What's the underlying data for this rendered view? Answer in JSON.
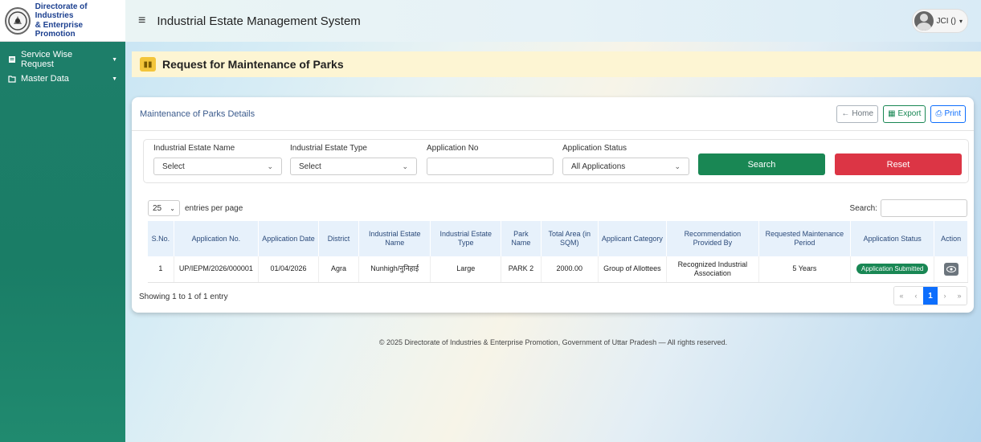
{
  "brand": {
    "line1": "Directorate of Industries",
    "line2": "& Enterprise Promotion"
  },
  "sidebar": {
    "items": [
      {
        "label": "Service Wise Request",
        "icon": "file-icon"
      },
      {
        "label": "Master Data",
        "icon": "folder-icon"
      }
    ]
  },
  "header": {
    "title": "Industrial Estate Management System",
    "user": "JCI ()"
  },
  "page": {
    "title": "Request for Maintenance of Parks"
  },
  "card": {
    "title": "Maintenance of Parks Details",
    "home": "Home",
    "export": "Export",
    "print": "Print"
  },
  "filters": {
    "estate_name_label": "Industrial Estate Name",
    "estate_name_value": "Select",
    "estate_type_label": "Industrial Estate Type",
    "estate_type_value": "Select",
    "app_no_label": "Application No",
    "app_no_value": "",
    "status_label": "Application Status",
    "status_value": "All Applications",
    "search": "Search",
    "reset": "Reset"
  },
  "table_controls": {
    "entries_value": "25",
    "entries_label": "entries per page",
    "search_label": "Search:"
  },
  "table": {
    "columns": [
      "S.No.",
      "Application No.",
      "Application Date",
      "District",
      "Industrial Estate Name",
      "Industrial Estate Type",
      "Park Name",
      "Total Area (in SQM)",
      "Applicant Category",
      "Recommendation Provided By",
      "Requested Maintenance Period",
      "Application Status",
      "Action"
    ],
    "rows": [
      [
        "1",
        "UP/IEPM/2026/000001",
        "01/04/2026",
        "Agra",
        "Nunhigh/नुनिहाई",
        "Large",
        "PARK 2",
        "2000.00",
        "Group of Allottees",
        "Recognized Industrial Association",
        "5 Years",
        "Application Submitted",
        ""
      ]
    ]
  },
  "pagination": {
    "showing": "Showing 1 to 1 of 1 entry",
    "first": "«",
    "prev": "‹",
    "current": "1",
    "next": "›",
    "last": "»"
  },
  "footer": {
    "text": "© 2025 Directorate of Industries & Enterprise Promotion, Government of Uttar Pradesh — All rights reserved."
  }
}
